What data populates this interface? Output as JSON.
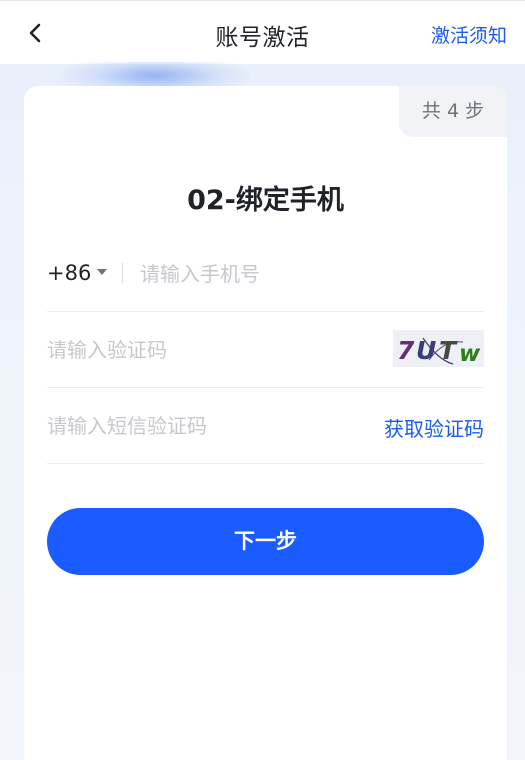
{
  "nav": {
    "title": "账号激活",
    "notice_link": "激活须知"
  },
  "card": {
    "steps_badge": "共 4 步",
    "title": "02-绑定手机"
  },
  "form": {
    "country_code": "+86",
    "phone_placeholder": "请输入手机号",
    "code_placeholder": "请输入验证码",
    "captcha_text": "7UTw",
    "sms_placeholder": "请输入短信验证码",
    "sms_button": "获取验证码",
    "next_button": "下一步"
  },
  "colors": {
    "accent": "#1a5cff",
    "link": "#1a5cf0",
    "placeholder": "#c5c8cd"
  }
}
